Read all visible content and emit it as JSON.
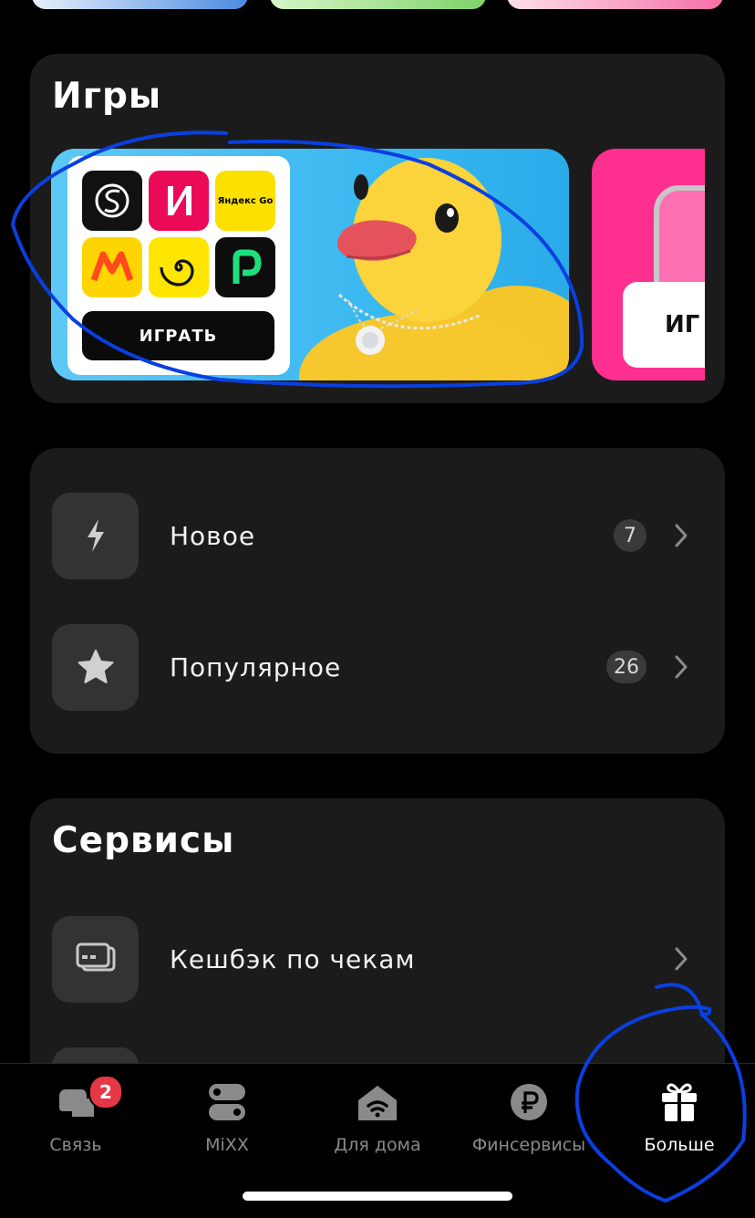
{
  "games": {
    "title": "Игры",
    "play_label": "ИГРАТЬ",
    "peek_label": "ИГ",
    "yandex_go_label": "Яндекс Go"
  },
  "menu": {
    "items": [
      {
        "label": "Новое",
        "count": "7",
        "icon": "lightning-icon"
      },
      {
        "label": "Популярное",
        "count": "26",
        "icon": "star-icon"
      }
    ]
  },
  "services": {
    "title": "Сервисы",
    "items": [
      {
        "label": "Кешбэк по чекам",
        "icon": "receipt-cards-icon"
      }
    ]
  },
  "tabbar": {
    "items": [
      {
        "label": "Связь",
        "icon": "chat-bubbles-icon",
        "badge": "2"
      },
      {
        "label": "MiXX",
        "icon": "toggles-icon"
      },
      {
        "label": "Для дома",
        "icon": "home-wifi-icon"
      },
      {
        "label": "Финсервисы",
        "icon": "ruble-icon"
      },
      {
        "label": "Больше",
        "icon": "gift-icon",
        "active": true
      }
    ]
  },
  "colors": {
    "background": "#000000",
    "panel": "#1b1b1b",
    "annotation": "#0a3fe0",
    "badge_red": "#e53745"
  }
}
